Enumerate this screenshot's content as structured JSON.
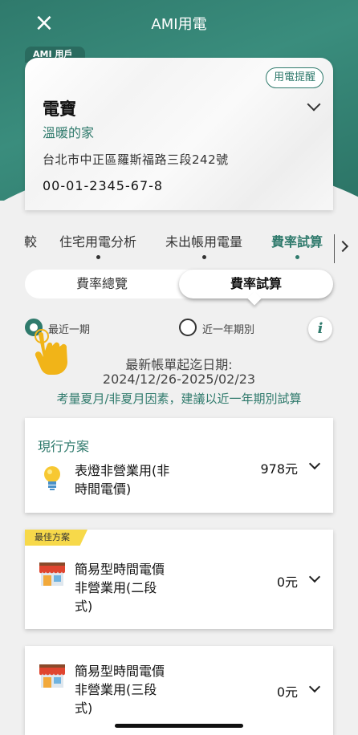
{
  "header": {
    "close_label": "×",
    "title": "AMI用電"
  },
  "account": {
    "tag": "AMI 用戶",
    "reminder_label": "用電提醒",
    "name": "電寶",
    "nickname": "溫暖的家",
    "address": "台北市中正區羅斯福路三段242號",
    "account_no": "00-01-2345-67-8"
  },
  "tabs": [
    {
      "label": "較"
    },
    {
      "label": "住宅用電分析"
    },
    {
      "label": "未出帳用電量"
    },
    {
      "label": "費率試算",
      "active": true
    }
  ],
  "segmented": {
    "option1": "費率總覽",
    "option2": "費率試算",
    "selected": "費率試算"
  },
  "period_options": {
    "recent": "最近一期",
    "year": "近一年期別",
    "selected": "最近一期"
  },
  "info_label": "i",
  "period": {
    "title": "最新帳單起迄日期:",
    "range": "2024/12/26-2025/02/23",
    "note": "考量夏月/非夏月因素，建議以近一年期別試算"
  },
  "plans": {
    "current": {
      "section_label": "現行方案",
      "name_line1": "表燈非營業用(非",
      "name_line2": "時間電價)",
      "price": "978元",
      "icon": "lightbulb-icon"
    },
    "best": {
      "tag": "最佳方案",
      "name_line1": "簡易型時間電價",
      "name_line2": "非營業用(二段",
      "name_line3": "式)",
      "price": "0元",
      "icon": "shop-icon"
    },
    "three": {
      "name_line1": "簡易型時間電價",
      "name_line2": "非營業用(三段",
      "name_line3": "式)",
      "price": "0元",
      "icon": "shop-icon"
    }
  },
  "colors": {
    "brand": "#2f7a6c",
    "best_tag": "#f7d94a",
    "hand": "#f1b418"
  }
}
